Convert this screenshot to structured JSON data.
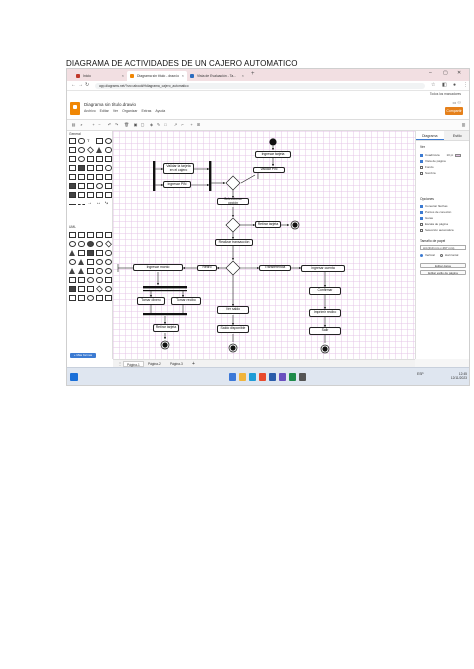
{
  "document": {
    "title": "DIAGRAMA DE ACTIVIDADES DE UN CAJERO AUTOMATICO"
  },
  "browser": {
    "tabs": [
      {
        "label": "Inicio",
        "color": "#c0392b",
        "active": false
      },
      {
        "label": "Diagrama sin título - draw.io",
        "color": "#f08705",
        "active": true
      },
      {
        "label": "Vista de Evaluación - Ta...",
        "color": "#2c6cbf",
        "active": false
      }
    ],
    "new_tab": "+",
    "url": "app.diagrams.net/?src=about#Hdiagrama_cajero_automatico",
    "bookmarks_label": "Todos los marcadores"
  },
  "drawio": {
    "doc_name": "Diagrama sin título.drawio",
    "menu": [
      "Archivo",
      "Editar",
      "Ver",
      "Organizar",
      "Extras",
      "Ayuda"
    ],
    "share_label": "Compartir",
    "more_shapes": "+ Más formas",
    "general_label": "General",
    "misc_label": "UML",
    "format_tabs": [
      "Diagrama",
      "Estilo"
    ],
    "format": {
      "view_label": "Ver",
      "grid_label": "Cuadrícula",
      "grid_size": "10 pt",
      "page_view_label": "Vista de página",
      "background_label": "Fondo",
      "shadow_label": "Sombra",
      "options_label": "Opciones",
      "options": [
        "Conectar flechas",
        "Puntos de conexión",
        "Guías",
        "Escala de página",
        "Selección automática"
      ],
      "page_size_label": "Tamaño de papel",
      "page_size_value": "A4 (210 mm x 297 mm)",
      "orientation": [
        "Vertical",
        "Horizontal"
      ],
      "edit_data_btn": "Editar datos",
      "edit_style_btn": "Editar estilo de página"
    },
    "pages": [
      "Página-1",
      "Página-2",
      "Página-3"
    ]
  },
  "diagram": {
    "nodes": {
      "ingresar_tarjeta": "Ingresar tarjeta",
      "validar_tarjeta": "Validar la tarjeta\nen el cajero",
      "ingresar_pin": "Ingresar PIN",
      "seleccionar_opcion": "Seleccionar opción",
      "validar_pin": "Validar PIN",
      "retirar_tarjeta_1": "Retirar tarjeta",
      "transaccion": "Realizar transacción",
      "retiro": "Retiro",
      "ingresar_monto": "Ingresar monto",
      "transferencia": "Transferencia",
      "ingresar_cuenta": "Ingresar cuenta",
      "tomar_dinero": "Tomar dinero",
      "tomar_recibo": "Tomar recibo",
      "imprimir_recibo": "Imprimir recibo",
      "retirar_tarjeta_2": "Retirar tarjeta",
      "confirmar": "Confirmar",
      "ver_saldo": "Ver saldo",
      "saldo_disponible": "Saldo disponible",
      "salir": "Salir"
    }
  },
  "taskbar": {
    "time": "12:45",
    "date": "12/11/2023",
    "lang": "ESP"
  }
}
